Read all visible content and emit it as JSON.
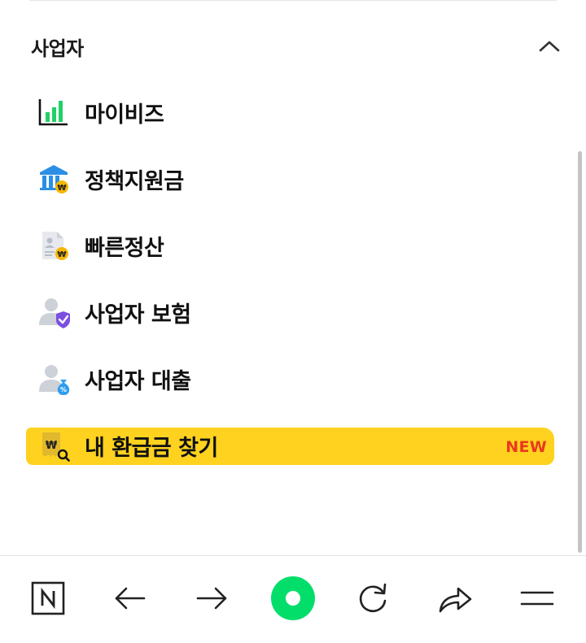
{
  "section": {
    "title": "사업자",
    "collapse_icon": "chevron-up-icon"
  },
  "menu": {
    "items": [
      {
        "label": "마이비즈",
        "icon": "bar-chart-icon"
      },
      {
        "label": "정책지원금",
        "icon": "bank-won-icon"
      },
      {
        "label": "빠른정산",
        "icon": "document-won-icon"
      },
      {
        "label": "사업자 보험",
        "icon": "person-shield-icon"
      },
      {
        "label": "사업자 대출",
        "icon": "person-money-bag-icon"
      },
      {
        "label": "내 환급금 찾기",
        "icon": "receipt-search-icon",
        "badge": "NEW",
        "highlighted": true
      }
    ]
  },
  "bottom_nav": {
    "items": [
      "naver-home-icon",
      "back-arrow-icon",
      "forward-arrow-icon",
      "green-circle-icon",
      "reload-icon",
      "share-icon",
      "menu-icon"
    ]
  },
  "colors": {
    "highlight": "#ffd21f",
    "badge_new": "#e83a1d",
    "naver_green": "#03de6b",
    "chart_green": "#21d066",
    "bank_blue": "#2b8fe6",
    "coin_gold": "#f5b800",
    "shield_purple": "#7b4fe0",
    "bag_blue": "#2f9df0"
  }
}
